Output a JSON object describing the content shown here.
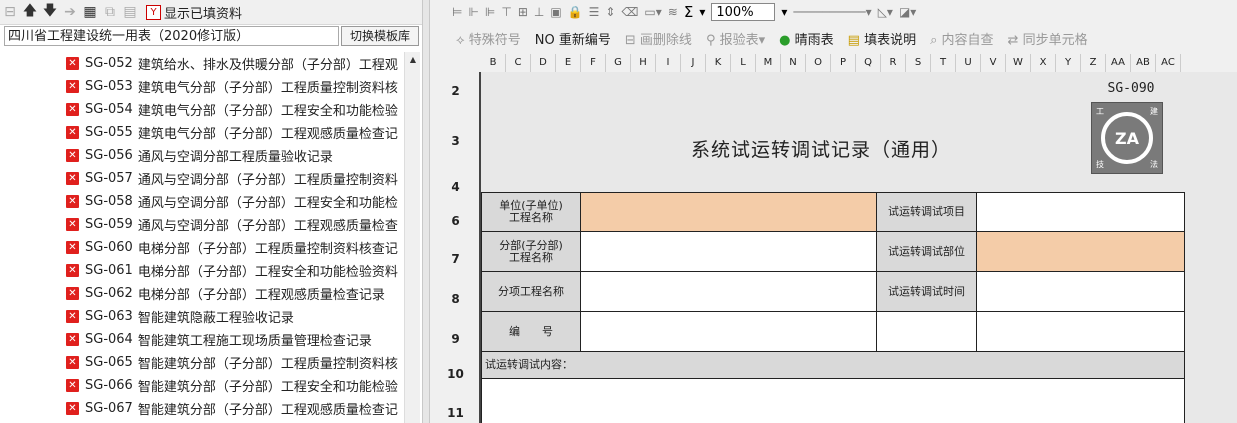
{
  "left_toolbar": {
    "show_filled_label": "显示已填资料"
  },
  "template_combo": {
    "value": "四川省工程建设统一用表（2020修订版）"
  },
  "switch_button": {
    "label": "切换模板库"
  },
  "tree": {
    "items": [
      {
        "code": "SG-052",
        "title": "建筑给水、排水及供暖分部（子分部）工程观"
      },
      {
        "code": "SG-053",
        "title": "建筑电气分部（子分部）工程质量控制资料核"
      },
      {
        "code": "SG-054",
        "title": "建筑电气分部（子分部）工程安全和功能检验"
      },
      {
        "code": "SG-055",
        "title": "建筑电气分部（子分部）工程观感质量检查记"
      },
      {
        "code": "SG-056",
        "title": "通风与空调分部工程质量验收记录"
      },
      {
        "code": "SG-057",
        "title": "通风与空调分部（子分部）工程质量控制资料"
      },
      {
        "code": "SG-058",
        "title": "通风与空调分部（子分部）工程安全和功能检"
      },
      {
        "code": "SG-059",
        "title": "通风与空调分部（子分部）工程观感质量检查"
      },
      {
        "code": "SG-060",
        "title": "电梯分部（子分部）工程质量控制资料核查记"
      },
      {
        "code": "SG-061",
        "title": "电梯分部（子分部）工程安全和功能检验资料"
      },
      {
        "code": "SG-062",
        "title": "电梯分部（子分部）工程观感质量检查记录"
      },
      {
        "code": "SG-063",
        "title": "智能建筑隐蔽工程验收记录"
      },
      {
        "code": "SG-064",
        "title": "智能建筑工程施工现场质量管理检查记录"
      },
      {
        "code": "SG-065",
        "title": "智能建筑分部（子分部）工程质量控制资料核"
      },
      {
        "code": "SG-066",
        "title": "智能建筑分部（子分部）工程安全和功能检验"
      },
      {
        "code": "SG-067",
        "title": "智能建筑分部（子分部）工程观感质量检查记"
      }
    ]
  },
  "right_toolbar1": {
    "sigma": "Σ",
    "zoom": "100%"
  },
  "right_toolbar2": {
    "special_symbol": "特殊符号",
    "renumber": "重新编号",
    "strike_line": "画删除线",
    "inspection_form": "报验表",
    "weather_form": "晴雨表",
    "fill_instructions": "填表说明",
    "content_check": "内容自查",
    "sync_cells": "同步单元格"
  },
  "sheet": {
    "columns": [
      "B",
      "C",
      "D",
      "E",
      "F",
      "G",
      "H",
      "I",
      "J",
      "K",
      "L",
      "M",
      "N",
      "O",
      "P",
      "Q",
      "R",
      "S",
      "T",
      "U",
      "V",
      "W",
      "X",
      "Y",
      "Z",
      "AA",
      "AB",
      "AC"
    ],
    "rows": [
      "2",
      "3",
      "4",
      "6",
      "7",
      "8",
      "9",
      "10",
      "11"
    ],
    "form_code": "SG-090",
    "form_title": "系统试运转调试记录（通用）",
    "logo_text": "ZA",
    "logo_corners": [
      "工",
      "建",
      "技",
      "法"
    ],
    "labels": {
      "unit_name": "单位(子单位)\n工程名称",
      "sub_part_name": "分部(子分部)\n工程名称",
      "item_name": "分项工程名称",
      "number": "编　　号",
      "test_item": "试运转调试项目",
      "test_part": "试运转调试部位",
      "test_time": "试运转调试时间",
      "content": "试运转调试内容："
    }
  }
}
